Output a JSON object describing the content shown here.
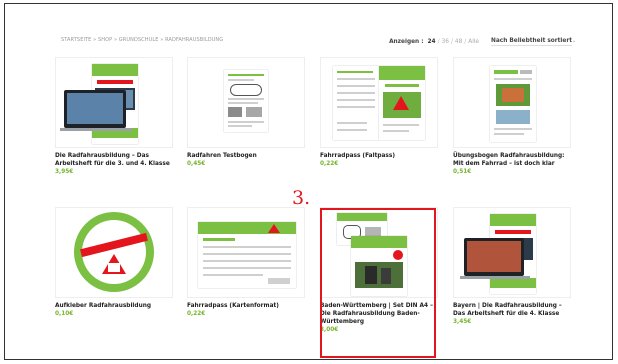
{
  "breadcrumb": "STARTSEITE » SHOP » GRUNDSCHULE » RADFAHRAUSBILDUNG",
  "toolbar": {
    "show_label": "Anzeigen :",
    "counts": [
      "24",
      "36",
      "48",
      "Alle"
    ],
    "active_count": "24",
    "sort_label": "Nach Beliebtheit sortiert",
    "sort_caret": "⌄"
  },
  "products": [
    {
      "title": "Die Radfahrausbildung – Das Arbeitsheft für die 3. und 4. Klasse",
      "price": "3,95€"
    },
    {
      "title": "Radfahren Testbogen",
      "price": "0,45€"
    },
    {
      "title": "Fahrradpass (Faltpass)",
      "price": "0,22€"
    },
    {
      "title": "Übungsbogen Radfahrausbildung: Mit dem Fahrrad – ist doch klar",
      "price": "0,51€"
    },
    {
      "title": "Aufkleber Radfahrausbildung",
      "price": "0,10€"
    },
    {
      "title": "Fahrradpass (Kartenformat)",
      "price": "0,22€"
    },
    {
      "title": "Baden-Württemberg | Set DIN A4 – Die Radfahrausbildung Baden-Württemberg",
      "price": "3,00€"
    },
    {
      "title": "Bayern | Die Radfahrausbildung – Das Arbeitsheft für die 4. Klasse",
      "price": "3,45€"
    }
  ],
  "highlight_rank": "3.",
  "colors": {
    "accent_green": "#77b52e",
    "highlight_red": "#e3161e"
  }
}
